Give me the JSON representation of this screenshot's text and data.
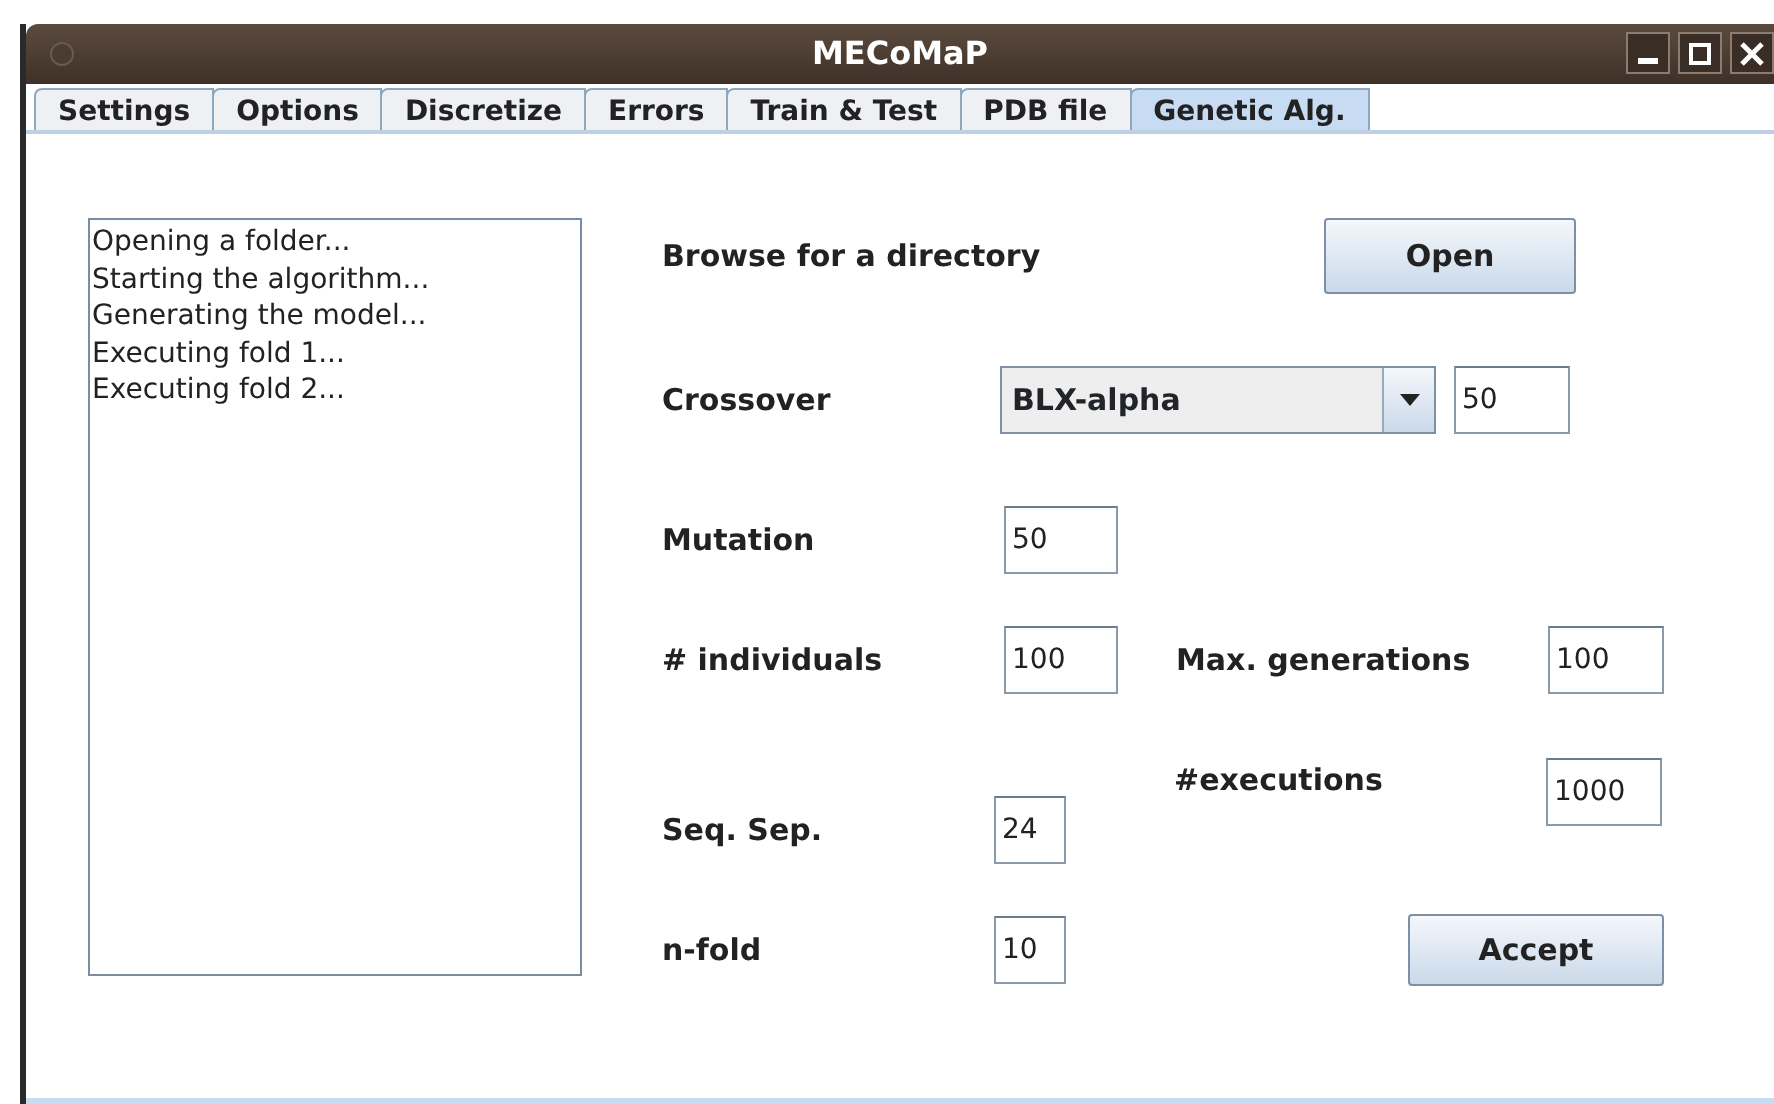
{
  "window": {
    "title": "MECoMaP"
  },
  "tabs": [
    {
      "label": "Settings",
      "selected": false
    },
    {
      "label": "Options",
      "selected": false
    },
    {
      "label": "Discretize",
      "selected": false
    },
    {
      "label": "Errors",
      "selected": false
    },
    {
      "label": "Train & Test",
      "selected": false
    },
    {
      "label": "PDB file",
      "selected": false
    },
    {
      "label": "Genetic Alg.",
      "selected": true
    }
  ],
  "log": [
    "Opening a folder...",
    "Starting the algorithm...",
    "Generating the model...",
    "Executing fold 1...",
    "Executing fold 2..."
  ],
  "browse": {
    "label": "Browse for a directory",
    "button": "Open"
  },
  "crossover": {
    "label": "Crossover",
    "value": "BLX-alpha",
    "field": "50"
  },
  "mutation": {
    "label": "Mutation",
    "value": "50"
  },
  "individuals": {
    "label": "# individuals",
    "value": "100"
  },
  "max_generations": {
    "label": "Max. generations",
    "value": "100"
  },
  "executions": {
    "label": "#executions",
    "value": "1000"
  },
  "seq_sep": {
    "label": "Seq. Sep.",
    "value": "24"
  },
  "n_fold": {
    "label": "n-fold",
    "value": "10"
  },
  "accept_button": "Accept"
}
